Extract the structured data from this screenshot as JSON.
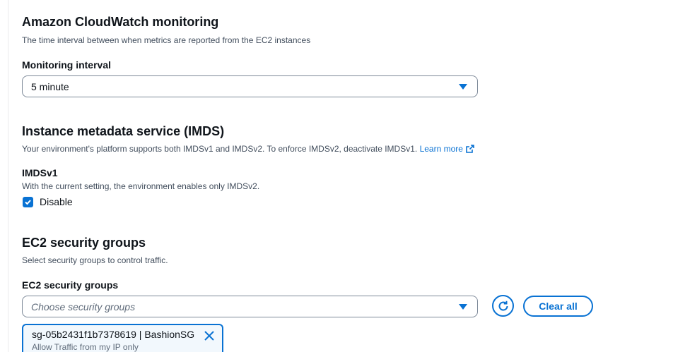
{
  "cloudwatch": {
    "title": "Amazon CloudWatch monitoring",
    "description": "The time interval between when metrics are reported from the EC2 instances",
    "interval_label": "Monitoring interval",
    "interval_value": "5 minute"
  },
  "imds": {
    "title": "Instance metadata service (IMDS)",
    "description": "Your environment's platform supports both IMDSv1 and IMDSv2. To enforce IMDSv2, deactivate IMDSv1.",
    "learn_more": "Learn more",
    "imdsv1_label": "IMDSv1",
    "imdsv1_description": "With the current setting, the environment enables only IMDSv2.",
    "disable_label": "Disable",
    "disable_checked": true
  },
  "security_groups": {
    "title": "EC2 security groups",
    "description": "Select security groups to control traffic.",
    "field_label": "EC2 security groups",
    "placeholder": "Choose security groups",
    "clear_all": "Clear all",
    "selected": [
      {
        "name": "sg-05b2431f1b7378619 | BashionSG",
        "description": "Allow Traffic from my IP only"
      }
    ]
  },
  "colors": {
    "accent": "#0972d3",
    "text": "#0f141a",
    "secondary_text": "#414d5c",
    "border": "#7d8998"
  },
  "icons": [
    "caret-down-icon",
    "external-link-icon",
    "checkmark-icon",
    "refresh-icon",
    "close-icon"
  ]
}
